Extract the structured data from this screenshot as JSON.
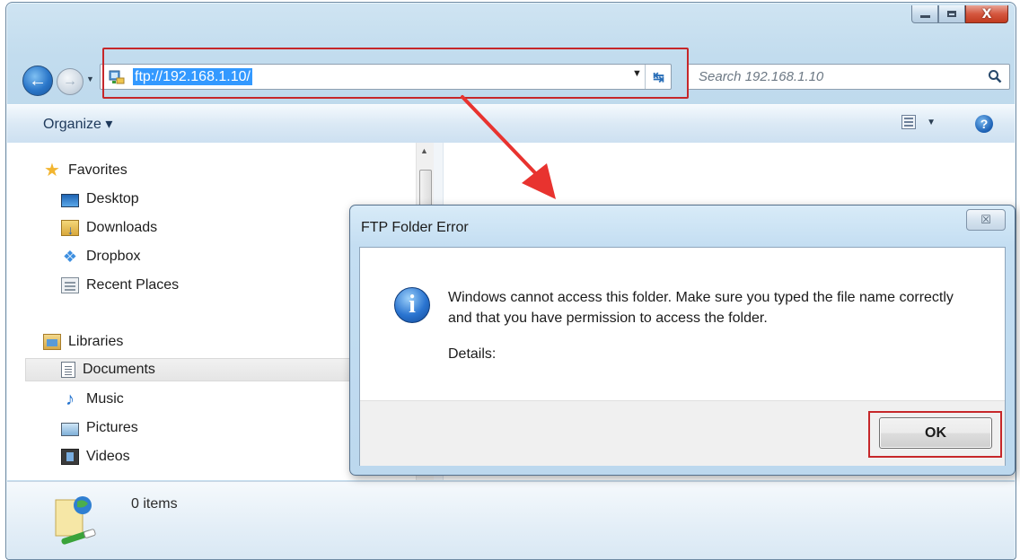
{
  "window": {
    "caption_buttons": {
      "minimize": "minimize",
      "maximize": "maximize",
      "close": "X"
    }
  },
  "navigation": {
    "address": "ftp://192.168.1.10/",
    "search_placeholder": "Search 192.168.1.10"
  },
  "toolbar": {
    "organize_label": "Organize ▾"
  },
  "sidebar": {
    "favorites_label": "Favorites",
    "favorites": [
      {
        "label": "Desktop",
        "icon": "desktop-icon"
      },
      {
        "label": "Downloads",
        "icon": "downloads-icon"
      },
      {
        "label": "Dropbox",
        "icon": "dropbox-icon"
      },
      {
        "label": "Recent Places",
        "icon": "recent-places-icon"
      }
    ],
    "libraries_label": "Libraries",
    "libraries": [
      {
        "label": "Documents",
        "icon": "documents-icon",
        "selected": true
      },
      {
        "label": "Music",
        "icon": "music-icon"
      },
      {
        "label": "Pictures",
        "icon": "pictures-icon"
      },
      {
        "label": "Videos",
        "icon": "videos-icon"
      }
    ]
  },
  "status": {
    "items_count": "0 items"
  },
  "dialog": {
    "title": "FTP Folder Error",
    "close_glyph": "☒",
    "message": "Windows cannot access this folder. Make sure you typed the file name correctly and that you have permission to access the folder.",
    "details_label": "Details:",
    "ok_label": "OK"
  },
  "annotations": {
    "highlight_color": "#c6272a",
    "arrow_color": "#e8332f"
  }
}
